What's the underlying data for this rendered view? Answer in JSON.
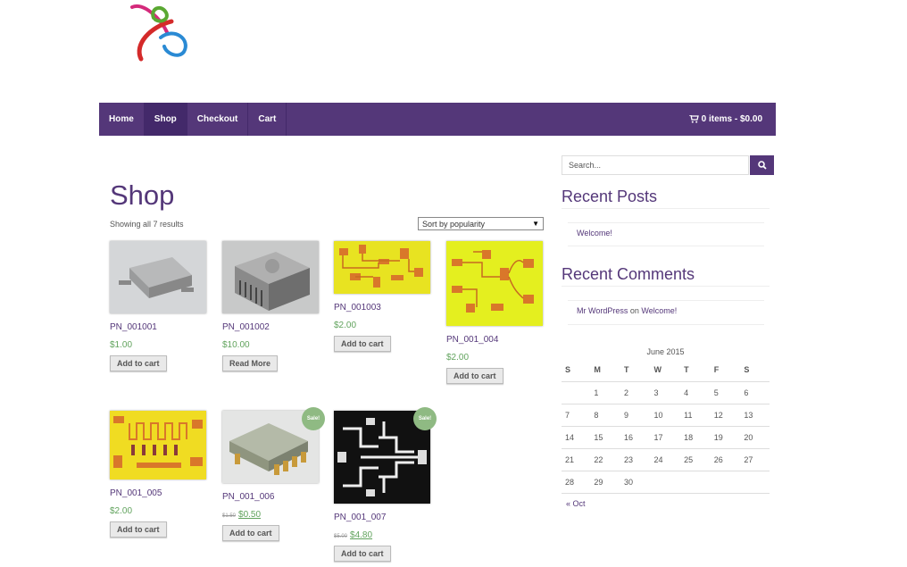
{
  "nav": {
    "items": [
      {
        "label": "Home",
        "active": false
      },
      {
        "label": "Shop",
        "active": true
      },
      {
        "label": "Checkout",
        "active": false
      },
      {
        "label": "Cart",
        "active": false
      }
    ],
    "cart_summary": "0 items - $0.00"
  },
  "shop": {
    "title": "Shop",
    "result_count": "Showing all 7 results",
    "sort_selected": "Sort by popularity"
  },
  "products": [
    {
      "name": "PN_001001",
      "price": "$1.00",
      "button": "Add to cart"
    },
    {
      "name": "PN_001002",
      "price": "$10.00",
      "button": "Read More"
    },
    {
      "name": "PN_001003",
      "price": "$2.00",
      "button": "Add to cart"
    },
    {
      "name": "PN_001_004",
      "price": "$2.00",
      "button": "Add to cart"
    },
    {
      "name": "PN_001_005",
      "price": "$2.00",
      "button": "Add to cart"
    },
    {
      "name": "PN_001_006",
      "old_price": "$1.50",
      "price": "$0.50",
      "button": "Add to cart",
      "badge": "Sale!"
    },
    {
      "name": "PN_001_007",
      "old_price": "$5.00",
      "price": "$4.80",
      "button": "Add to cart",
      "badge": "Sale!"
    }
  ],
  "sidebar": {
    "search_placeholder": "Search...",
    "recent_posts_title": "Recent Posts",
    "recent_posts": [
      "Welcome!"
    ],
    "recent_comments_title": "Recent Comments",
    "recent_comment": {
      "author": "Mr WordPress",
      "connector": " on ",
      "post": "Welcome!"
    },
    "calendar": {
      "caption": "June 2015",
      "weekdays": [
        "S",
        "M",
        "T",
        "W",
        "T",
        "F",
        "S"
      ],
      "weeks": [
        [
          "",
          "1",
          "2",
          "3",
          "4",
          "5",
          "6"
        ],
        [
          "7",
          "8",
          "9",
          "10",
          "11",
          "12",
          "13"
        ],
        [
          "14",
          "15",
          "16",
          "17",
          "18",
          "19",
          "20"
        ],
        [
          "21",
          "22",
          "23",
          "24",
          "25",
          "26",
          "27"
        ],
        [
          "28",
          "29",
          "30",
          "",
          "",
          "",
          ""
        ]
      ],
      "prev_link": "« Oct"
    }
  },
  "colors": {
    "brand": "#543779",
    "price_green": "#61a35d",
    "sale_badge": "#8fba83"
  }
}
